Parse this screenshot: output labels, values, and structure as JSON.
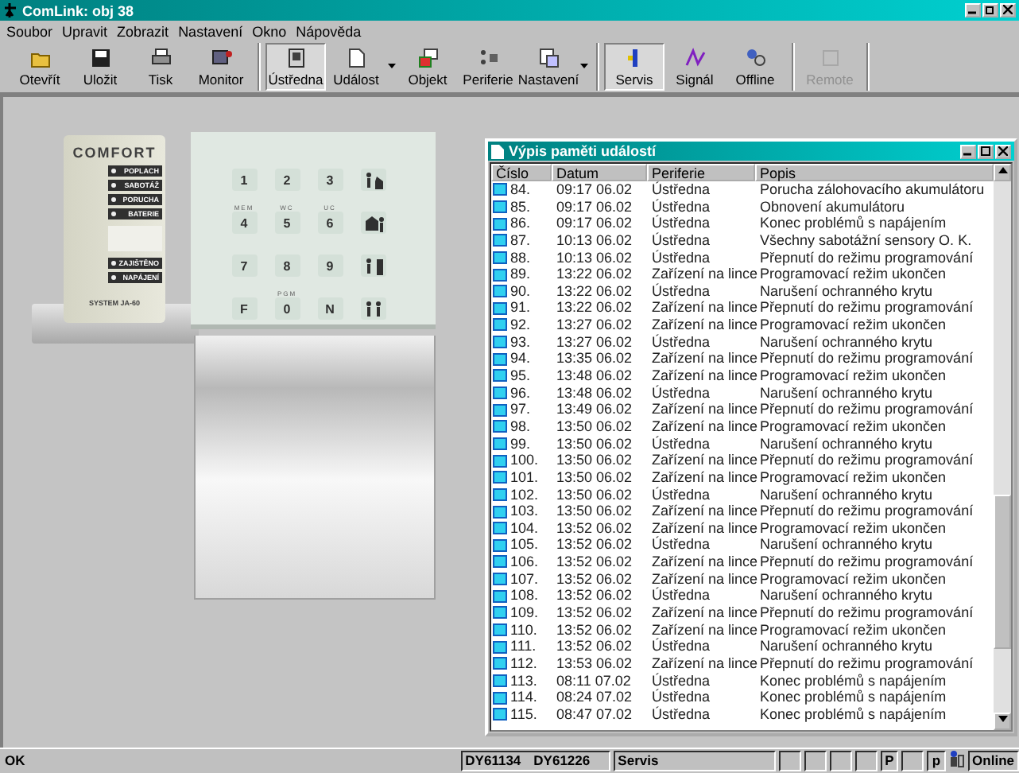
{
  "window": {
    "title": "ComLink: obj 38"
  },
  "menu": [
    {
      "label": "Soubor"
    },
    {
      "label": "Upravit"
    },
    {
      "label": "Zobrazit"
    },
    {
      "label": "Nastavení"
    },
    {
      "label": "Okno"
    },
    {
      "label": "Nápověda"
    }
  ],
  "toolbar": {
    "groups": [
      [
        {
          "label": "Otevřít",
          "pressed": false,
          "disabled": false,
          "dropdown": false
        },
        {
          "label": "Uložit",
          "pressed": false,
          "disabled": false,
          "dropdown": false
        },
        {
          "label": "Tisk",
          "pressed": false,
          "disabled": false,
          "dropdown": false
        },
        {
          "label": "Monitor",
          "pressed": false,
          "disabled": false,
          "dropdown": false
        }
      ],
      [
        {
          "label": "Ústředna",
          "pressed": true,
          "disabled": false,
          "dropdown": false
        },
        {
          "label": "Událost",
          "pressed": false,
          "disabled": false,
          "dropdown": true
        },
        {
          "label": "Objekt",
          "pressed": false,
          "disabled": false,
          "dropdown": false
        },
        {
          "label": "Periferie",
          "pressed": false,
          "disabled": false,
          "dropdown": false
        },
        {
          "label": "Nastavení",
          "pressed": false,
          "disabled": false,
          "dropdown": true
        }
      ],
      [
        {
          "label": "Servis",
          "pressed": true,
          "disabled": false,
          "dropdown": false
        },
        {
          "label": "Signál",
          "pressed": false,
          "disabled": false,
          "dropdown": false
        },
        {
          "label": "Offline",
          "pressed": false,
          "disabled": false,
          "dropdown": false
        }
      ],
      [
        {
          "label": "Remote",
          "pressed": false,
          "disabled": true,
          "dropdown": false
        }
      ]
    ]
  },
  "keypad": {
    "brand": "COMFORT",
    "indicators": [
      {
        "label": "POPLACH"
      },
      {
        "label": "SABOTÁŽ"
      },
      {
        "label": "PORUCHA"
      },
      {
        "label": "BATERIE"
      },
      {
        "label": "ZAJIŠTĚNO"
      },
      {
        "label": "NAPÁJENÍ"
      }
    ],
    "system": "SYSTEM JA-60",
    "key_rows": [
      [
        {
          "label": "1"
        },
        {
          "label": "2"
        },
        {
          "label": "3"
        }
      ],
      [
        {
          "label": "4",
          "sub": "MEM"
        },
        {
          "label": "5",
          "sub": "WC"
        },
        {
          "label": "6",
          "sub": "UC"
        }
      ],
      [
        {
          "label": "7"
        },
        {
          "label": "8"
        },
        {
          "label": "9"
        }
      ],
      [
        {
          "label": "F"
        },
        {
          "label": "0",
          "sub": "PGM"
        },
        {
          "label": "N"
        }
      ]
    ]
  },
  "event_window": {
    "title": "Výpis paměti událostí",
    "columns": [
      "Číslo",
      "Datum",
      "Periferie",
      "Popis"
    ],
    "rows": [
      [
        "84.",
        "09:17 06.02",
        "Ústředna",
        "Porucha zálohovacího akumulátoru"
      ],
      [
        "85.",
        "09:17 06.02",
        "Ústředna",
        "Obnovení akumulátoru"
      ],
      [
        "86.",
        "09:17 06.02",
        "Ústředna",
        "Konec problémů s napájením"
      ],
      [
        "87.",
        "10:13 06.02",
        "Ústředna",
        "Všechny sabotážní sensory O. K."
      ],
      [
        "88.",
        "10:13 06.02",
        "Ústředna",
        "Přepnutí do režimu programování"
      ],
      [
        "89.",
        "13:22 06.02",
        "Zařízení na lince",
        "Programovací režim ukončen"
      ],
      [
        "90.",
        "13:22 06.02",
        "Ústředna",
        "Narušení ochranného krytu"
      ],
      [
        "91.",
        "13:22 06.02",
        "Zařízení na lince",
        "Přepnutí do režimu programování"
      ],
      [
        "92.",
        "13:27 06.02",
        "Zařízení na lince",
        "Programovací režim ukončen"
      ],
      [
        "93.",
        "13:27 06.02",
        "Ústředna",
        "Narušení ochranného krytu"
      ],
      [
        "94.",
        "13:35 06.02",
        "Zařízení na lince",
        "Přepnutí do režimu programování"
      ],
      [
        "95.",
        "13:48 06.02",
        "Zařízení na lince",
        "Programovací režim ukončen"
      ],
      [
        "96.",
        "13:48 06.02",
        "Ústředna",
        "Narušení ochranného krytu"
      ],
      [
        "97.",
        "13:49 06.02",
        "Zařízení na lince",
        "Přepnutí do režimu programování"
      ],
      [
        "98.",
        "13:50 06.02",
        "Zařízení na lince",
        "Programovací režim ukončen"
      ],
      [
        "99.",
        "13:50 06.02",
        "Ústředna",
        "Narušení ochranného krytu"
      ],
      [
        "100.",
        "13:50 06.02",
        "Zařízení na lince",
        "Přepnutí do režimu programování"
      ],
      [
        "101.",
        "13:50 06.02",
        "Zařízení na lince",
        "Programovací režim ukončen"
      ],
      [
        "102.",
        "13:50 06.02",
        "Ústředna",
        "Narušení ochranného krytu"
      ],
      [
        "103.",
        "13:50 06.02",
        "Zařízení na lince",
        "Přepnutí do režimu programování"
      ],
      [
        "104.",
        "13:52 06.02",
        "Zařízení na lince",
        "Programovací režim ukončen"
      ],
      [
        "105.",
        "13:52 06.02",
        "Ústředna",
        "Narušení ochranného krytu"
      ],
      [
        "106.",
        "13:52 06.02",
        "Zařízení na lince",
        "Přepnutí do režimu programování"
      ],
      [
        "107.",
        "13:52 06.02",
        "Zařízení na lince",
        "Programovací režim ukončen"
      ],
      [
        "108.",
        "13:52 06.02",
        "Ústředna",
        "Narušení ochranného krytu"
      ],
      [
        "109.",
        "13:52 06.02",
        "Zařízení na lince",
        "Přepnutí do režimu programování"
      ],
      [
        "110.",
        "13:52 06.02",
        "Zařízení na lince",
        "Programovací režim ukončen"
      ],
      [
        "111.",
        "13:52 06.02",
        "Ústředna",
        "Narušení ochranného krytu"
      ],
      [
        "112.",
        "13:53 06.02",
        "Zařízení na lince",
        "Přepnutí do režimu programování"
      ],
      [
        "113.",
        "08:11 07.02",
        "Ústředna",
        "Konec problémů s napájením"
      ],
      [
        "114.",
        "08:24 07.02",
        "Ústředna",
        "Konec problémů s napájením"
      ],
      [
        "115.",
        "08:47 07.02",
        "Ústředna",
        "Konec problémů s napájením"
      ]
    ]
  },
  "status_bar": {
    "message": "OK",
    "codes": [
      "DY61134",
      "DY61226"
    ],
    "mode": "Servis",
    "flags": [
      "P",
      "p"
    ],
    "connection": "Online"
  }
}
